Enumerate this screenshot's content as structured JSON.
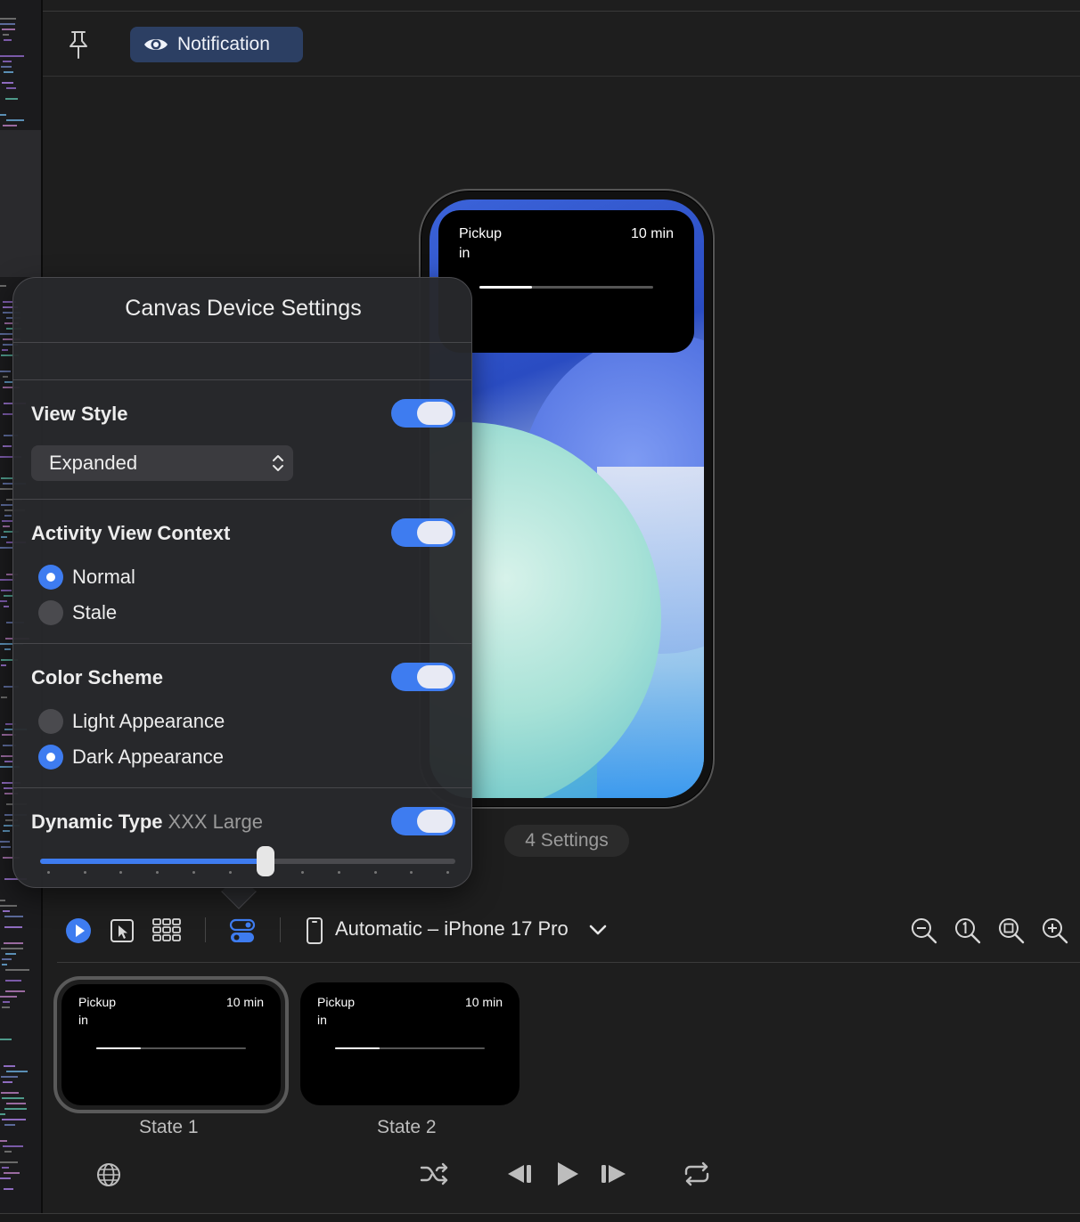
{
  "toolbar": {
    "notification_label": "Notification"
  },
  "preview": {
    "live_activity": {
      "title": "Pickup\nin",
      "time": "10 min",
      "progress": 0.3
    },
    "settings_badge": "4 Settings"
  },
  "popover": {
    "title": "Canvas Device Settings",
    "view_style": {
      "label": "View Style",
      "enabled": true,
      "selected": "Expanded"
    },
    "activity_context": {
      "label": "Activity View Context",
      "enabled": true,
      "options": [
        "Normal",
        "Stale"
      ],
      "selected": "Normal"
    },
    "color_scheme": {
      "label": "Color Scheme",
      "enabled": true,
      "options": [
        "Light Appearance",
        "Dark Appearance"
      ],
      "selected": "Dark Appearance"
    },
    "dynamic_type": {
      "label": "Dynamic Type",
      "value_label": "XXX Large",
      "enabled": true,
      "level": 6,
      "steps": 12
    }
  },
  "bottom_bar": {
    "device": "Automatic – iPhone 17 Pro",
    "icons": [
      "play-icon",
      "select-icon",
      "grid-icon",
      "device-settings-icon",
      "phone-icon",
      "zoom-out-icon",
      "zoom-100-icon",
      "zoom-fit-icon",
      "zoom-in-icon"
    ]
  },
  "states": [
    {
      "label": "State 1",
      "title": "Pickup\nin",
      "time": "10 min",
      "selected": true
    },
    {
      "label": "State 2",
      "title": "Pickup\nin",
      "time": "10 min",
      "selected": false
    }
  ],
  "colors": {
    "accent": "#3e7cf0",
    "badge": "#2c3f63"
  }
}
